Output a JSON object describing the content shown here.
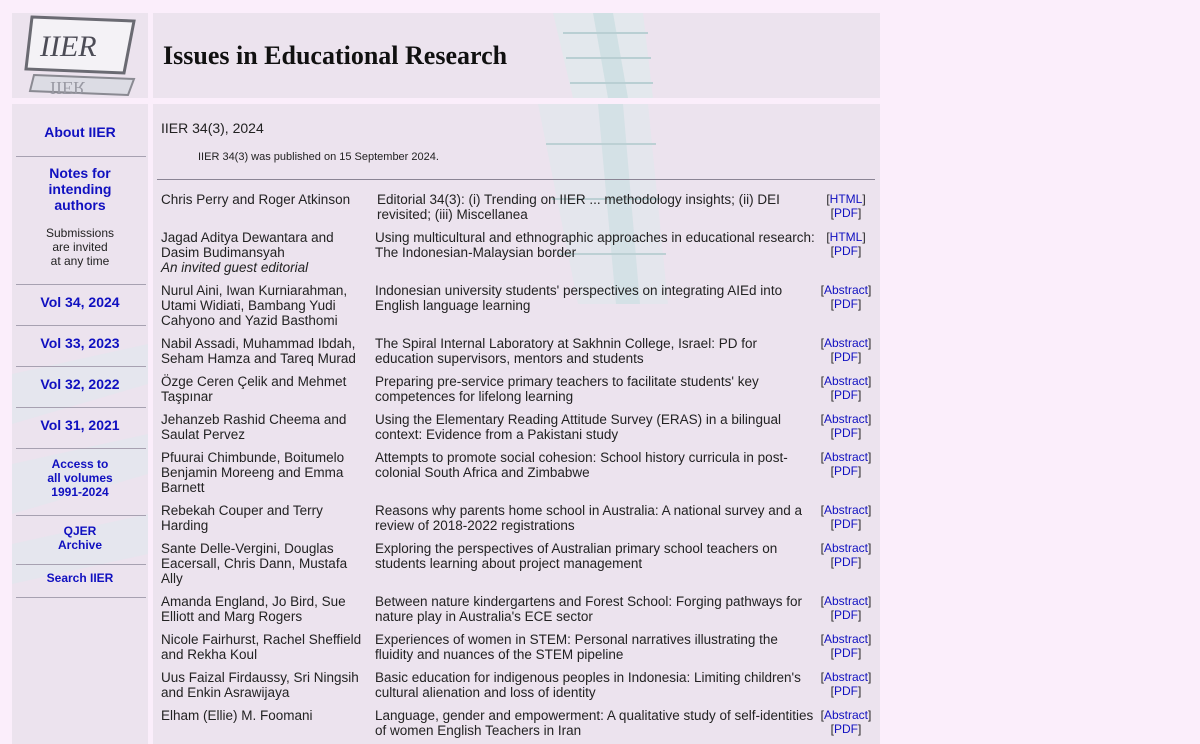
{
  "header": {
    "logo_text": "IIER",
    "site_title": "Issues in Educational Research"
  },
  "sidebar": {
    "about": "About IIER",
    "notes_line1": "Notes for",
    "notes_line2": "intending",
    "notes_line3": "authors",
    "submissions_line1": "Submissions",
    "submissions_line2": "are invited",
    "submissions_line3": "at any time",
    "vol34": "Vol 34, 2024",
    "vol33": "Vol 33, 2023",
    "vol32": "Vol 32, 2022",
    "vol31": "Vol 31, 2021",
    "access_line1": "Access to",
    "access_line2": "all volumes",
    "access_line3": "1991-2024",
    "qjer_line1": "QJER",
    "qjer_line2": "Archive",
    "search": "Search IIER"
  },
  "main": {
    "issue_title": "IIER 34(3), 2024",
    "publication_note": "IIER 34(3) was published on 15 September 2024."
  },
  "articles": [
    {
      "authors": "Chris Perry and Roger Atkinson",
      "note": "",
      "title": "Editorial 34(3): (i) Trending on IIER ... methodology insights; (ii) DEI revisited; (iii) Miscellanea",
      "link1": "HTML",
      "link2": "PDF"
    },
    {
      "authors": "Jagad Aditya Dewantara and Dasim Budimansyah",
      "note": "An invited guest editorial",
      "title": "Using multicultural and ethnographic approaches in educational research: The Indonesian-Malaysian border",
      "link1": "HTML",
      "link2": "PDF"
    },
    {
      "authors": "Nurul Aini, Iwan Kurniarahman, Utami Widiati, Bambang Yudi Cahyono and Yazid Basthomi",
      "note": "",
      "title": "Indonesian university students' perspectives on integrating AIEd into English language learning",
      "link1": "Abstract",
      "link2": "PDF"
    },
    {
      "authors": "Nabil Assadi, Muhammad Ibdah, Seham Hamza and Tareq Murad",
      "note": "",
      "title": "The Spiral Internal Laboratory at Sakhnin College, Israel: PD for education supervisors, mentors and students",
      "link1": "Abstract",
      "link2": "PDF"
    },
    {
      "authors": "Özge Ceren Çelik and Mehmet Taşpınar",
      "note": "",
      "title": "Preparing pre-service primary teachers to facilitate students' key competences for lifelong learning",
      "link1": "Abstract",
      "link2": "PDF"
    },
    {
      "authors": "Jehanzeb Rashid Cheema and Saulat Pervez",
      "note": "",
      "title": "Using the Elementary Reading Attitude Survey (ERAS) in a bilingual context: Evidence from a Pakistani study",
      "link1": "Abstract",
      "link2": "PDF"
    },
    {
      "authors": "Pfuurai Chimbunde, Boitumelo Benjamin Moreeng and Emma Barnett",
      "note": "",
      "title": "Attempts to promote social cohesion: School history curricula in post-colonial South Africa and Zimbabwe",
      "link1": "Abstract",
      "link2": "PDF"
    },
    {
      "authors": "Rebekah Couper and Terry Harding",
      "note": "",
      "title": "Reasons why parents home school in Australia: A national survey and a review of 2018-2022 registrations",
      "link1": "Abstract",
      "link2": "PDF"
    },
    {
      "authors": "Sante Delle-Vergini, Douglas Eacersall, Chris Dann, Mustafa Ally",
      "note": "",
      "title": "Exploring the perspectives of Australian primary school teachers on students learning about project management",
      "link1": "Abstract",
      "link2": "PDF"
    },
    {
      "authors": "Amanda England, Jo Bird, Sue Elliott and Marg Rogers",
      "note": "",
      "title": "Between nature kindergartens and Forest School: Forging pathways for nature play in Australia's ECE sector",
      "link1": "Abstract",
      "link2": "PDF"
    },
    {
      "authors": "Nicole Fairhurst, Rachel Sheffield and Rekha Koul",
      "note": "",
      "title": "Experiences of women in STEM: Personal narratives illustrating the fluidity and nuances of the STEM pipeline",
      "link1": "Abstract",
      "link2": "PDF"
    },
    {
      "authors": "Uus Faizal Firdaussy, Sri Ningsih and Enkin Asrawijaya",
      "note": "",
      "title": "Basic education for indigenous peoples in Indonesia: Limiting children's cultural alienation and loss of identity",
      "link1": "Abstract",
      "link2": "PDF"
    },
    {
      "authors": "Elham (Ellie) M. Foomani",
      "note": "",
      "title": "Language, gender and empowerment: A qualitative study of self-identities of women English Teachers in Iran",
      "link1": "Abstract",
      "link2": "PDF"
    }
  ],
  "colors": {
    "page_background": "#fbeefb",
    "panel_background": "#ece3ee",
    "link": "#1010c0"
  }
}
